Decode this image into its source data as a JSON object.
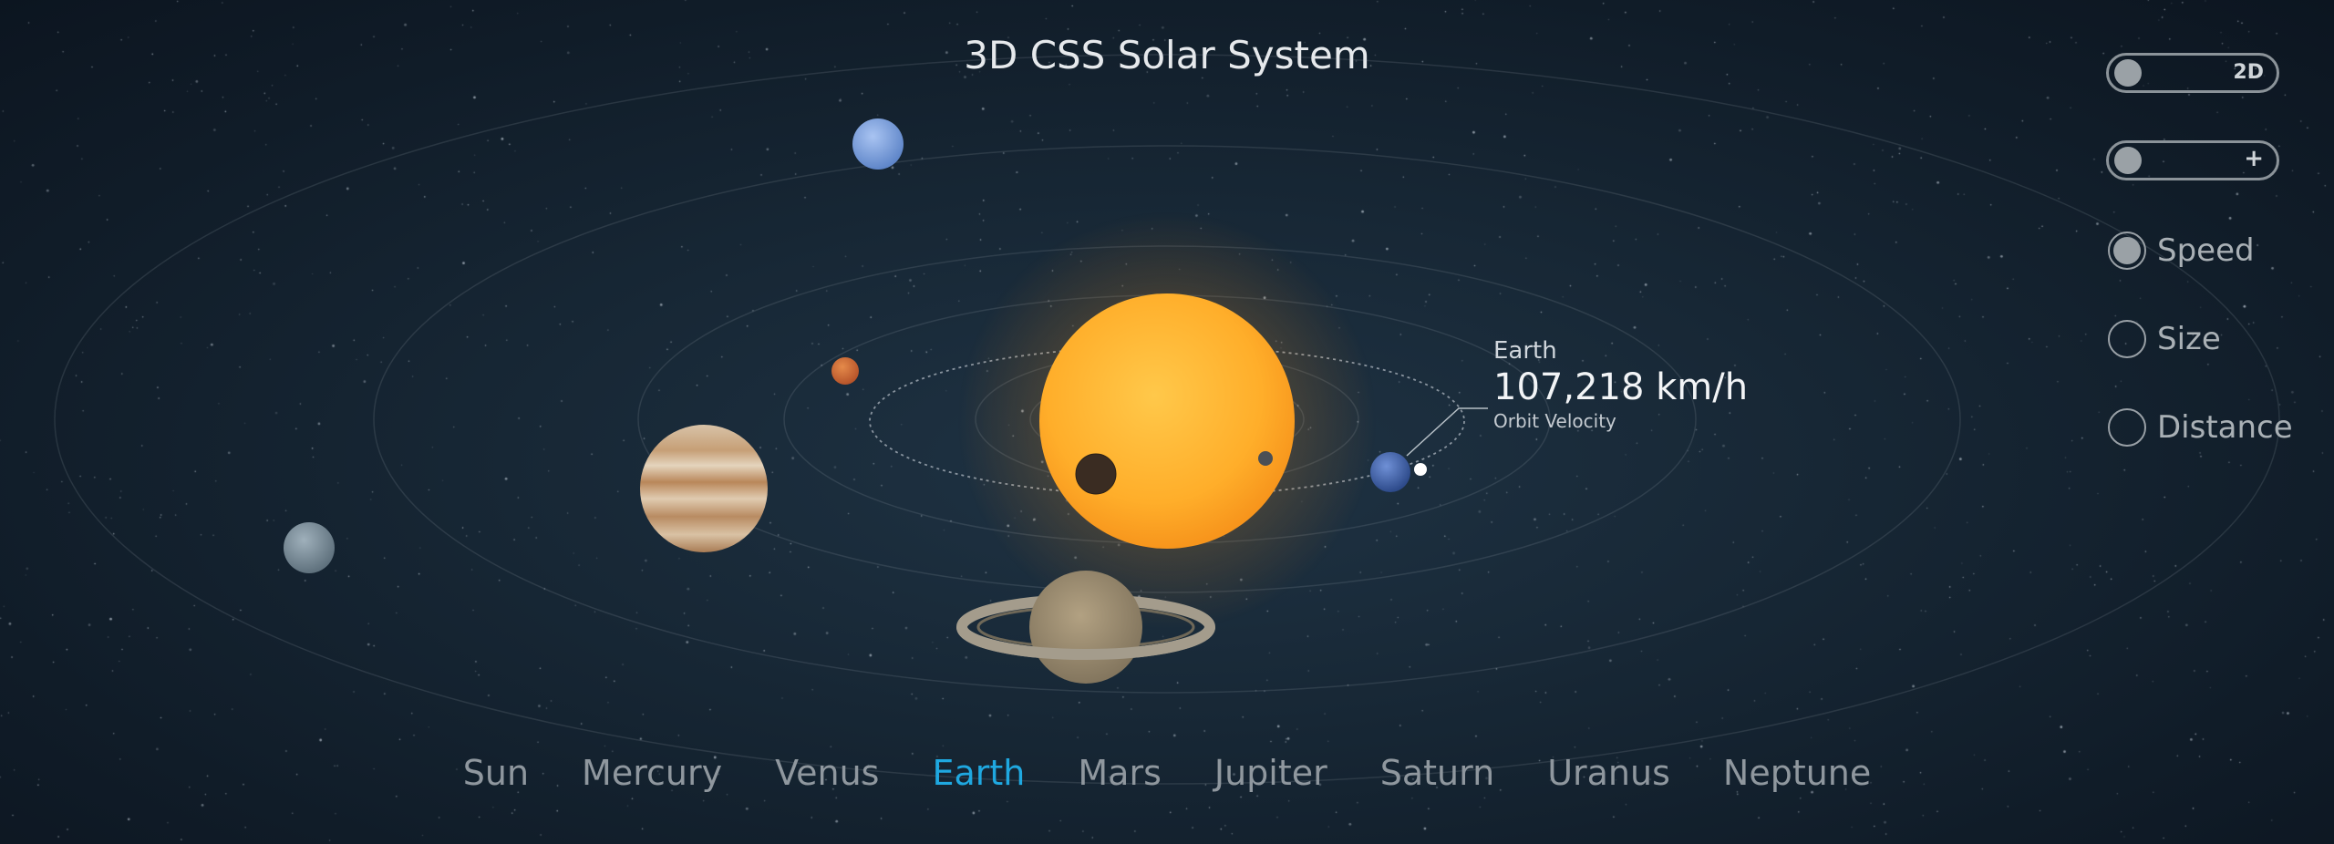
{
  "title": "3D CSS Solar System",
  "readout": {
    "planet": "Earth",
    "value": "107,218 km/h",
    "label": "Orbit Velocity"
  },
  "controls": {
    "view_toggle": {
      "label": "2D",
      "on": false
    },
    "zoom_toggle": {
      "label": "+",
      "on": false
    },
    "modes": [
      {
        "label": "Speed",
        "selected": true
      },
      {
        "label": "Size",
        "selected": false
      },
      {
        "label": "Distance",
        "selected": false
      }
    ]
  },
  "nav": {
    "items": [
      "Sun",
      "Mercury",
      "Venus",
      "Earth",
      "Mars",
      "Jupiter",
      "Saturn",
      "Uranus",
      "Neptune"
    ],
    "active": "Earth"
  },
  "colors": {
    "accent": "#1fa8e0",
    "sun": "#ffb12c",
    "background": "#172735"
  },
  "icons": {
    "view_toggle": "toggle-switch",
    "zoom_toggle": "plus-icon"
  }
}
